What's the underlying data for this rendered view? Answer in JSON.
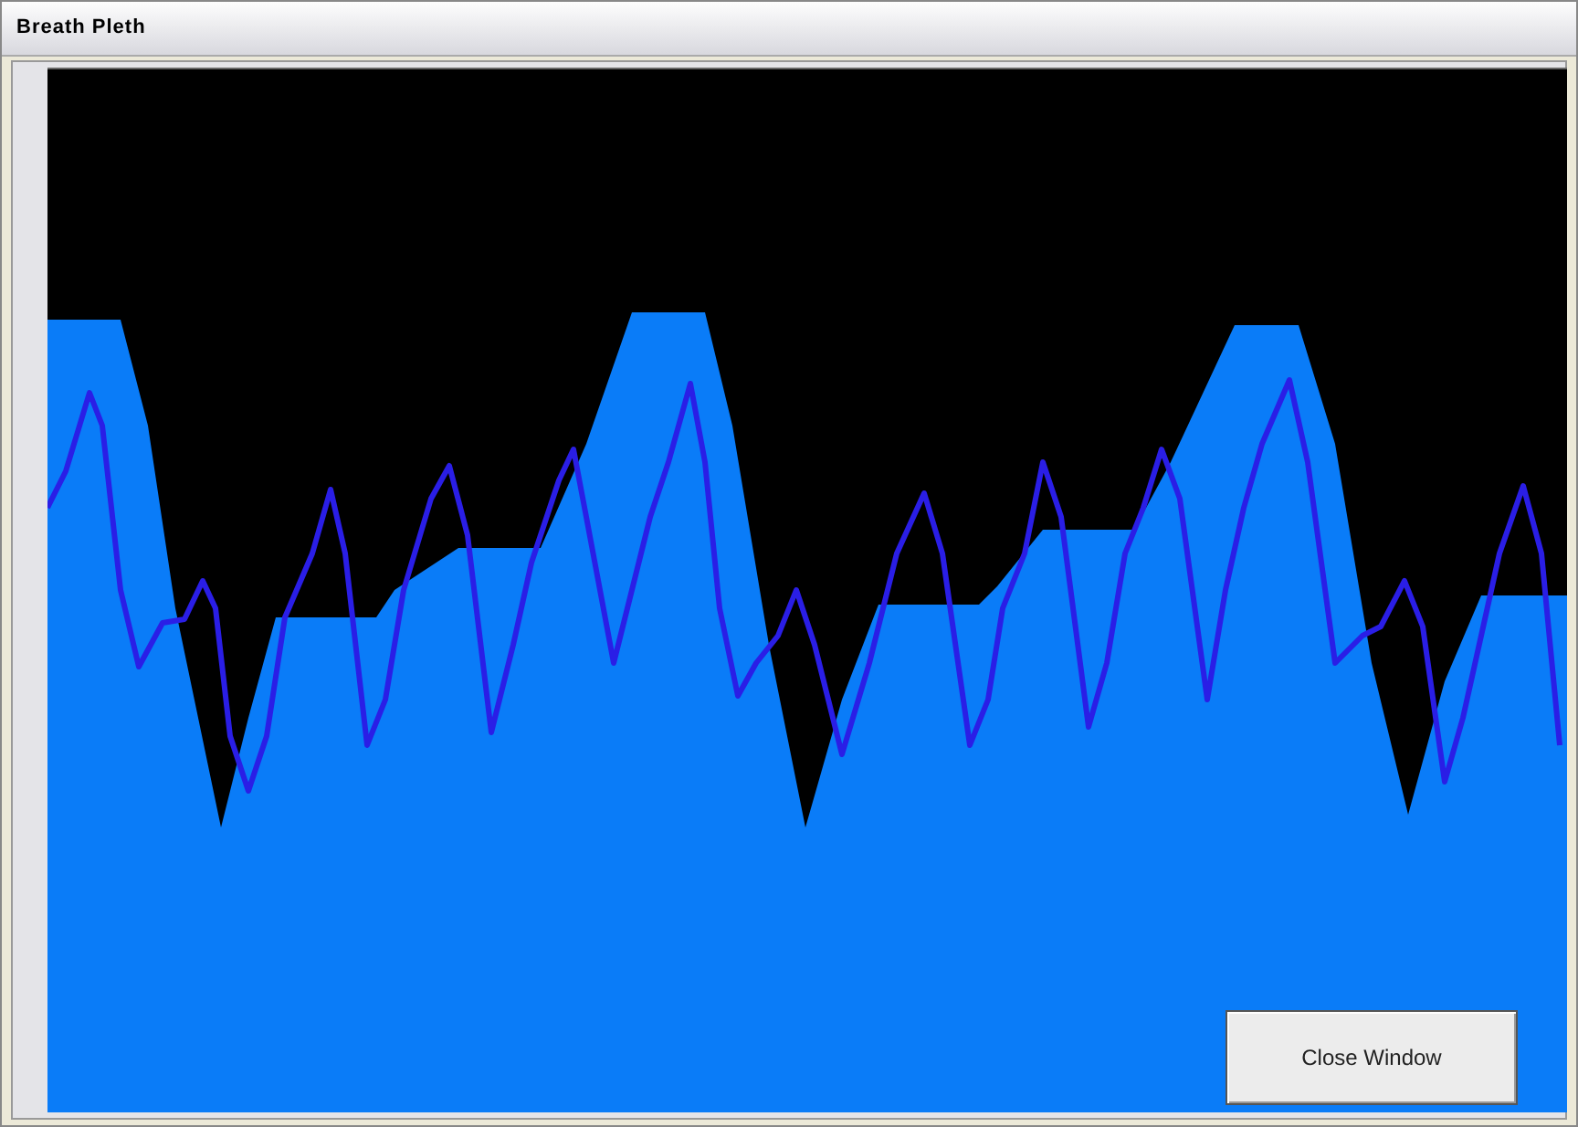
{
  "window": {
    "title": "Breath Pleth"
  },
  "buttons": [
    {
      "label": "Close Window"
    }
  ]
}
